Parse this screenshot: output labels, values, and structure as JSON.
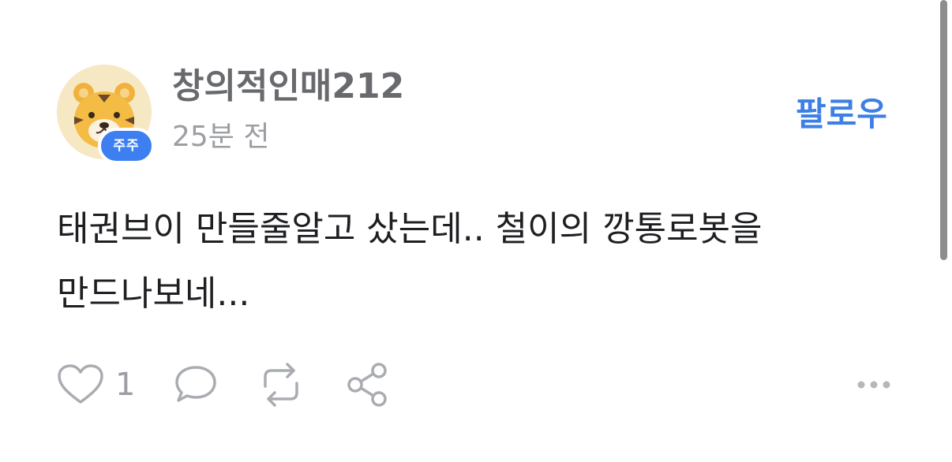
{
  "post": {
    "author": {
      "name": "창의적인매212",
      "badge": "주주",
      "avatar_icon": "tiger-avatar-icon"
    },
    "timestamp": "25분 전",
    "follow_label": "팔로우",
    "content_lines": [
      "태권브이 만들줄알고 샀는데.. 철이의 깡통로봇을",
      "만드나보네..."
    ],
    "actions": {
      "like_icon": "heart-icon",
      "like_count": "1",
      "comment_icon": "comment-icon",
      "repost_icon": "repost-icon",
      "share_icon": "share-icon",
      "more_icon": "more-icon"
    },
    "colors": {
      "accent": "#3d7fe3",
      "badge": "#3d7ff0",
      "text": "#1e1f22",
      "muted": "#9b9ea3"
    }
  }
}
